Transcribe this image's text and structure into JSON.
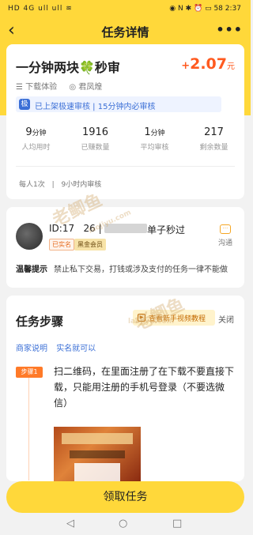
{
  "status": {
    "left_icons": "HD 4G ull ull ≋",
    "right_icons": "◉ N ✱ ⏰ ▭",
    "battery": "58",
    "time": "2:37"
  },
  "header": {
    "back_glyph": "‹",
    "title": "任务详情",
    "more_glyph": "•••"
  },
  "task": {
    "title": "一分钟两块🍀秒审",
    "price_plus": "+",
    "price": "2.07",
    "price_unit": "元",
    "tags": [
      "☰ 下载体验",
      "◎ 君凤煌"
    ],
    "audit_badge": "极",
    "audit_text": "已上架极速审核  |  15分钟内必审核",
    "stats": [
      {
        "value": "9",
        "unit": "分钟",
        "label": "人均用时"
      },
      {
        "value": "1916",
        "unit": "",
        "label": "已赚数量"
      },
      {
        "value": "1",
        "unit": "分钟",
        "label": "平均审核"
      },
      {
        "value": "217",
        "unit": "",
        "label": "剩余数量"
      }
    ],
    "limits": [
      "每人1次",
      "|",
      "9小时内审核"
    ]
  },
  "publisher": {
    "id_prefix": "ID:17",
    "id_suffix": "26  |",
    "name_tail": "单子秒过",
    "badge_real": "已实名",
    "badge_gold": "黑金会员",
    "chat_label": "沟通",
    "tip_label": "温馨提示",
    "tip_text": "禁止私下交易，打钱或涉及支付的任务一律不能做"
  },
  "steps": {
    "title": "任务步骤",
    "tutorial": "查看新手视频教程",
    "close": "关闭",
    "links": [
      "商家说明",
      "实名就可以"
    ],
    "step_badge": "步骤1",
    "step_text": "扫二维码，在里面注册了在下载不要直接下载，只能用注册的手机号登录（不要选微信）"
  },
  "watermark": {
    "text": "老鲫鱼",
    "site": "laojiyu.com"
  },
  "claim_label": "领取任务",
  "nav": {
    "back": "◁",
    "home": "○",
    "recent": "□"
  }
}
